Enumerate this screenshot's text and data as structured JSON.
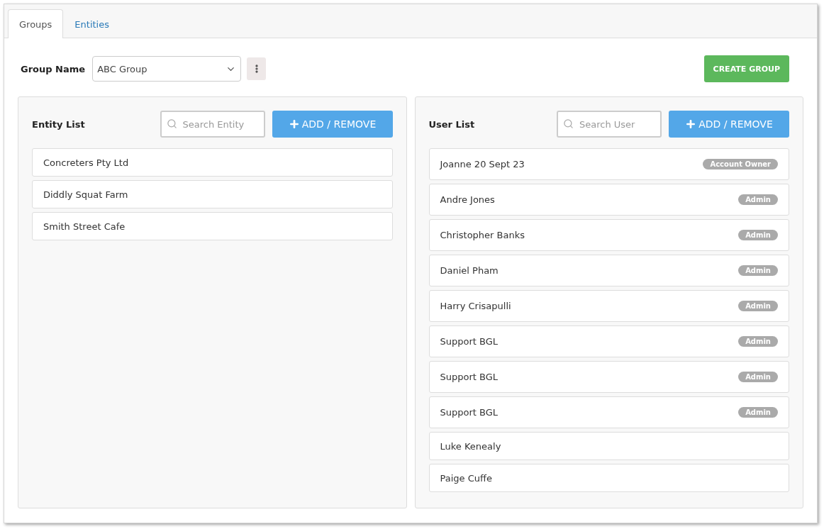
{
  "tabs": [
    {
      "label": "Groups",
      "selected": true
    },
    {
      "label": "Entities",
      "selected": false
    }
  ],
  "group_name": {
    "label": "Group Name",
    "value": "ABC Group"
  },
  "create_button": "CREATE GROUP",
  "entity_panel": {
    "title": "Entity List",
    "search_placeholder": "Search Entity",
    "button": "ADD / REMOVE",
    "items": [
      {
        "name": "Concreters Pty Ltd"
      },
      {
        "name": "Diddly Squat Farm"
      },
      {
        "name": "Smith Street Cafe"
      }
    ]
  },
  "user_panel": {
    "title": "User List",
    "search_placeholder": "Search User",
    "button": "ADD / REMOVE",
    "items": [
      {
        "name": "Joanne 20 Sept 23",
        "role": "Account Owner"
      },
      {
        "name": "Andre Jones",
        "role": "Admin"
      },
      {
        "name": "Christopher Banks",
        "role": "Admin"
      },
      {
        "name": "Daniel Pham",
        "role": "Admin"
      },
      {
        "name": "Harry Crisapulli",
        "role": "Admin"
      },
      {
        "name": "Support BGL",
        "role": "Admin"
      },
      {
        "name": "Support BGL",
        "role": "Admin"
      },
      {
        "name": "Support BGL",
        "role": "Admin"
      },
      {
        "name": "Luke Kenealy"
      },
      {
        "name": "Paige Cuffe"
      }
    ]
  }
}
